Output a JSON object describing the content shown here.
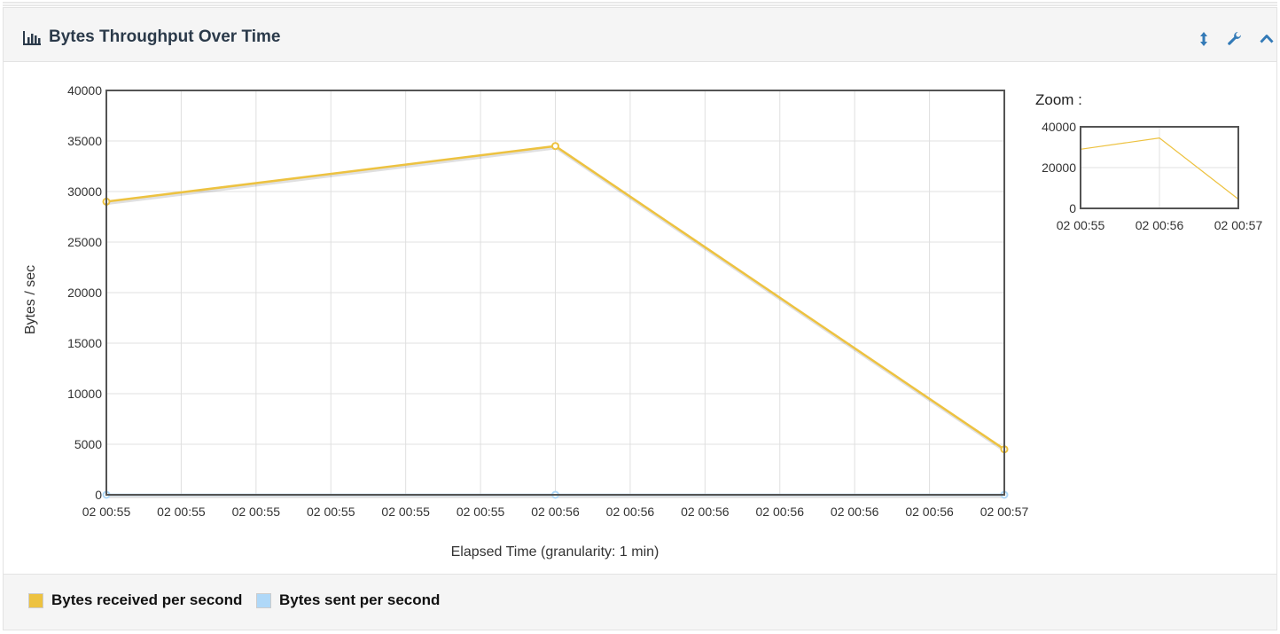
{
  "panel": {
    "title": "Bytes Throughput Over Time",
    "icons": [
      "bar-chart-icon",
      "vertical-resize-icon",
      "wrench-icon",
      "chevron-up-icon"
    ]
  },
  "zoom_label": "Zoom :",
  "colors": {
    "received": "#edc240",
    "sent": "#afd8f8",
    "frame": "#545454",
    "grid": "#e0e0e0",
    "accent": "#337ab7"
  },
  "chart_data": [
    {
      "type": "line",
      "xlabel": "Elapsed Time (granularity: 1 min)",
      "ylabel": "Bytes / sec",
      "tick_labels": [
        "02 00:55",
        "02 00:55",
        "02 00:55",
        "02 00:55",
        "02 00:55",
        "02 00:55",
        "02 00:56",
        "02 00:56",
        "02 00:56",
        "02 00:56",
        "02 00:56",
        "02 00:56",
        "02 00:57"
      ],
      "x": [
        "02 00:55",
        "02 00:56",
        "02 00:57"
      ],
      "yticks": [
        0,
        5000,
        10000,
        15000,
        20000,
        25000,
        30000,
        35000,
        40000
      ],
      "ylim": [
        0,
        40000
      ],
      "grid": true,
      "series": [
        {
          "name": "Bytes received per second",
          "values": [
            29000,
            34500,
            4500
          ]
        },
        {
          "name": "Bytes sent per second",
          "values": [
            0,
            0,
            0
          ]
        }
      ]
    },
    {
      "type": "line",
      "title": "Zoom :",
      "tick_labels": [
        "02 00:55",
        "02 00:56",
        "02 00:57"
      ],
      "yticks": [
        0,
        20000,
        40000
      ],
      "ylim": [
        0,
        40000
      ],
      "grid": true,
      "series": [
        {
          "name": "Bytes received per second",
          "values": [
            29000,
            34500,
            4500
          ]
        },
        {
          "name": "Bytes sent per second",
          "values": [
            0,
            0,
            0
          ]
        }
      ]
    }
  ],
  "legend": [
    {
      "label": "Bytes received per second",
      "color": "#edc240"
    },
    {
      "label": "Bytes sent per second",
      "color": "#afd8f8"
    }
  ]
}
